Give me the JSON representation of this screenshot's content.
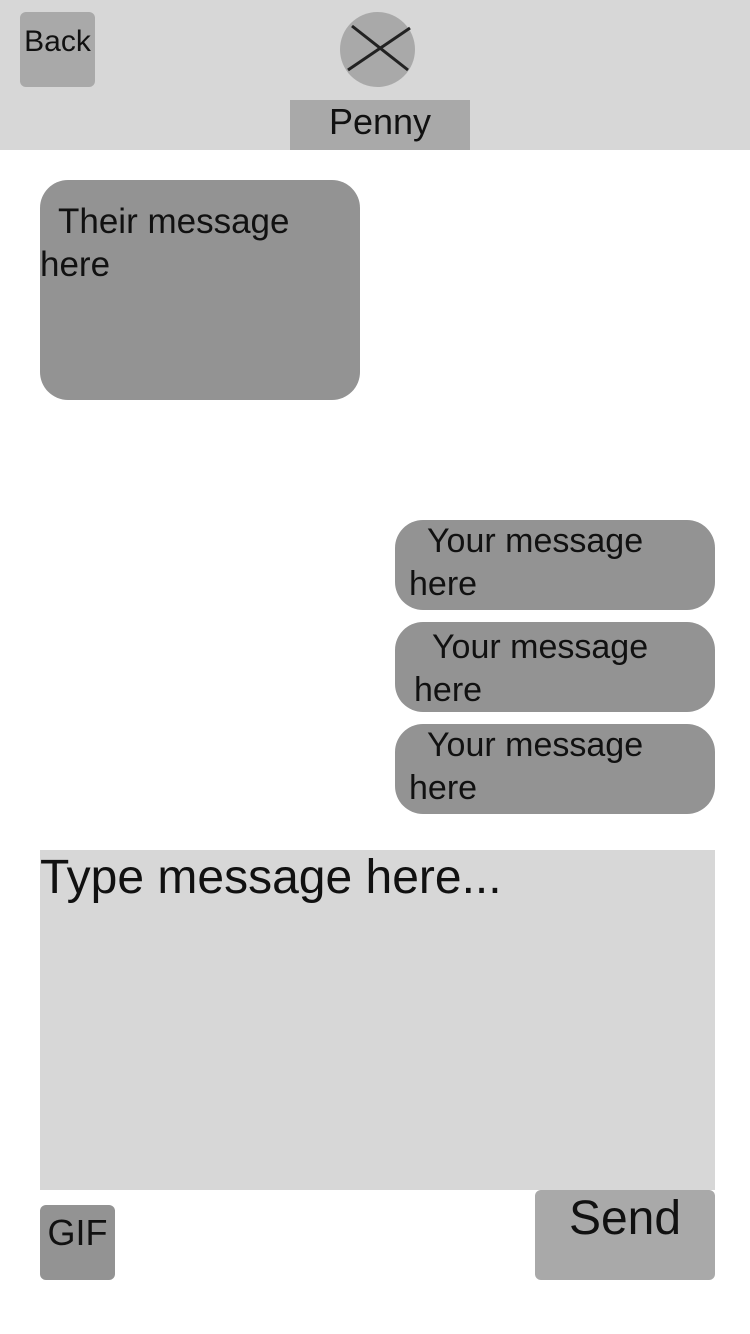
{
  "header": {
    "back_label": "Back",
    "avatar_icon": "placeholder-image-icon",
    "contact_name": "Penny"
  },
  "messages": {
    "theirs": [
      {
        "text": "Their message here"
      }
    ],
    "mine": [
      {
        "text": "Your message here"
      },
      {
        "text": "Your message here"
      },
      {
        "text": "Your message here"
      }
    ]
  },
  "composer": {
    "placeholder": "Type message here...",
    "value": "",
    "gif_label": "GIF",
    "send_label": "Send"
  },
  "colors": {
    "header_bg": "#d7d7d7",
    "button_bg": "#a9a9a9",
    "bubble_bg": "#939393",
    "page_bg": "#ffffff"
  }
}
